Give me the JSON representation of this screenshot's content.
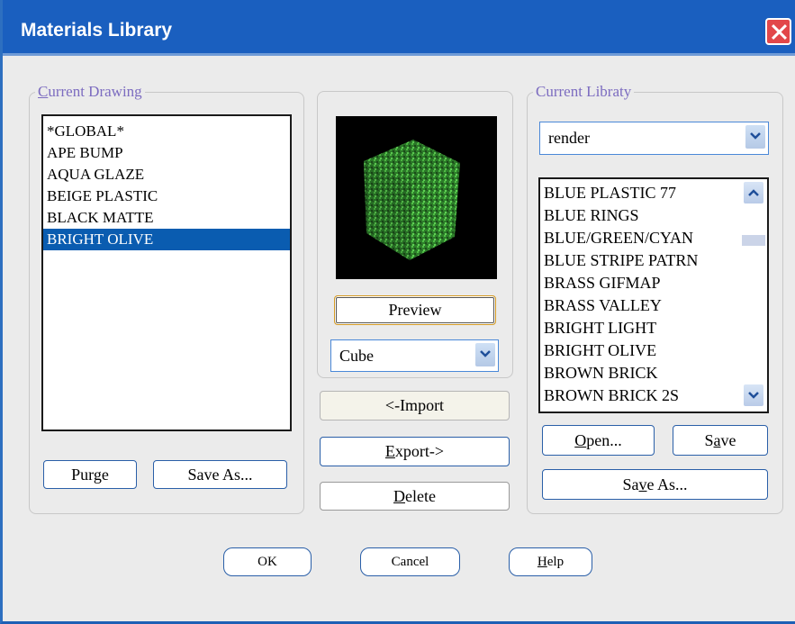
{
  "window": {
    "title": "Materials Library"
  },
  "current_drawing": {
    "legend_first": "C",
    "legend_rest": "urrent Drawing",
    "items": [
      "*GLOBAL*",
      "APE BUMP",
      "AQUA GLAZE",
      "BEIGE PLASTIC",
      "BLACK MATTE",
      "BRIGHT OLIVE"
    ],
    "selected_index": 5,
    "purge_label": "Purge",
    "save_as_label": "Save As..."
  },
  "preview": {
    "shape_name": "green-textured-cube",
    "preview_label": "Preview",
    "shape_select": "Cube"
  },
  "actions": {
    "import_label": "<-Import",
    "export_first": "E",
    "export_rest": "xport->",
    "delete_first": "D",
    "delete_rest": "elete"
  },
  "current_library": {
    "legend": "Current Libraty",
    "library_select": "render",
    "items": [
      "BLUE PLASTIC 77",
      "BLUE RINGS",
      "BLUE/GREEN/CYAN",
      "BLUE STRIPE PATRN",
      "BRASS GIFMAP",
      "BRASS VALLEY",
      "BRIGHT LIGHT",
      "BRIGHT OLIVE",
      "BROWN BRICK",
      "BROWN BRICK 2S"
    ],
    "open_first": "O",
    "open_rest": "pen...",
    "save_pre": "S",
    "save_u": "a",
    "save_post": "ve",
    "saveas_pre": "Sa",
    "saveas_u": "v",
    "saveas_post": "e As..."
  },
  "footer": {
    "ok_label": "OK",
    "cancel_label": "Cancel",
    "help_first": "H",
    "help_rest": "elp"
  },
  "colors": {
    "titlebar": "#1a5fbf",
    "selection": "#0a5cb0",
    "close": "#e2474a",
    "legend": "#7c6cc0"
  },
  "icons": [
    "close-icon",
    "chevron-down-icon",
    "chevron-up-icon"
  ]
}
